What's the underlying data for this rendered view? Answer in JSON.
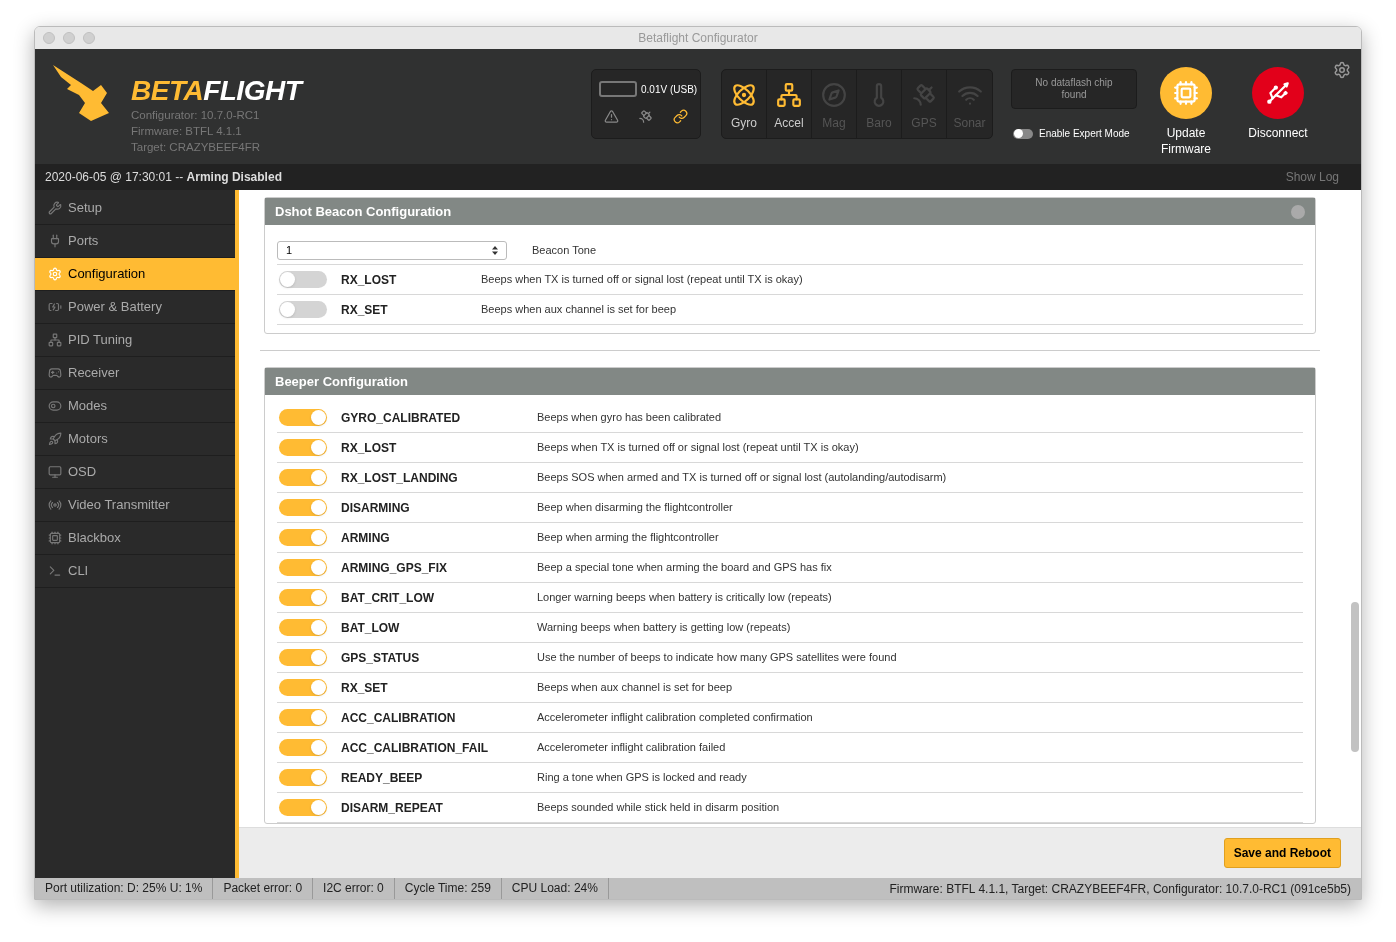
{
  "window": {
    "title": "Betaflight Configurator"
  },
  "logo": {
    "parts": [
      {
        "text": "BETA",
        "color": "#ffbb33"
      },
      {
        "text": "FLIGHT",
        "color": "#ffffff"
      }
    ],
    "info": [
      "Configurator: 10.7.0-RC1",
      "Firmware: BTFL 4.1.1",
      "Target: CRAZYBEEF4FR"
    ]
  },
  "battery": {
    "reading": "0.01V (USB)"
  },
  "sensors": [
    {
      "label": "Gyro",
      "kind": "gyro",
      "active": true
    },
    {
      "label": "Accel",
      "kind": "accel",
      "active": true
    },
    {
      "label": "Mag",
      "kind": "mag",
      "active": false
    },
    {
      "label": "Baro",
      "kind": "baro",
      "active": false
    },
    {
      "label": "GPS",
      "kind": "gps",
      "active": false
    },
    {
      "label": "Sonar",
      "kind": "sonar",
      "active": false
    }
  ],
  "dataflash": "No dataflash chip found",
  "expert_mode": {
    "label": "Enable Expert Mode",
    "on": false
  },
  "header_buttons": [
    {
      "label": "Update Firmware",
      "kind": "update"
    },
    {
      "label": "Disconnect",
      "kind": "disconnect"
    }
  ],
  "status_line": {
    "text": "2020-06-05 @ 17:30:01 -- **Arming Disabled**",
    "show_log": "Show Log"
  },
  "sidebar": {
    "items": [
      {
        "label": "Setup",
        "kind": "setup",
        "selected": false
      },
      {
        "label": "Ports",
        "kind": "ports",
        "selected": false
      },
      {
        "label": "Configuration",
        "kind": "config",
        "selected": true
      },
      {
        "label": "Power & Battery",
        "kind": "power",
        "selected": false
      },
      {
        "label": "PID Tuning",
        "kind": "pid",
        "selected": false
      },
      {
        "label": "Receiver",
        "kind": "receiver",
        "selected": false
      },
      {
        "label": "Modes",
        "kind": "modes",
        "selected": false
      },
      {
        "label": "Motors",
        "kind": "motors",
        "selected": false
      },
      {
        "label": "OSD",
        "kind": "osd",
        "selected": false
      },
      {
        "label": "Video Transmitter",
        "kind": "vtx",
        "selected": false
      },
      {
        "label": "Blackbox",
        "kind": "blackbox",
        "selected": false
      },
      {
        "label": "CLI",
        "kind": "cli",
        "selected": false
      }
    ]
  },
  "dshot_beacon": {
    "title": "Dshot Beacon Configuration",
    "tone": {
      "value": "1",
      "label": "Beacon Tone"
    },
    "rows": [
      {
        "name": "RX_LOST",
        "description": "Beeps when TX is turned off or signal lost (repeat until TX is okay)",
        "on": false
      },
      {
        "name": "RX_SET",
        "description": "Beeps when aux channel is set for beep",
        "on": false
      }
    ]
  },
  "beeper": {
    "title": "Beeper Configuration",
    "rows": [
      {
        "name": "GYRO_CALIBRATED",
        "description": "Beeps when gyro has been calibrated",
        "on": true
      },
      {
        "name": "RX_LOST",
        "description": "Beeps when TX is turned off or signal lost (repeat until TX is okay)",
        "on": true
      },
      {
        "name": "RX_LOST_LANDING",
        "description": "Beeps SOS when armed and TX is turned off or signal lost (autolanding/autodisarm)",
        "on": true
      },
      {
        "name": "DISARMING",
        "description": "Beep when disarming the flightcontroller",
        "on": true
      },
      {
        "name": "ARMING",
        "description": "Beep when arming the flightcontroller",
        "on": true
      },
      {
        "name": "ARMING_GPS_FIX",
        "description": "Beep a special tone when arming the board and GPS has fix",
        "on": true
      },
      {
        "name": "BAT_CRIT_LOW",
        "description": "Longer warning beeps when battery is critically low (repeats)",
        "on": true
      },
      {
        "name": "BAT_LOW",
        "description": "Warning beeps when battery is getting low (repeats)",
        "on": true
      },
      {
        "name": "GPS_STATUS",
        "description": "Use the number of beeps to indicate how many GPS satellites were found",
        "on": true
      },
      {
        "name": "RX_SET",
        "description": "Beeps when aux channel is set for beep",
        "on": true
      },
      {
        "name": "ACC_CALIBRATION",
        "description": "Accelerometer inflight calibration completed confirmation",
        "on": true
      },
      {
        "name": "ACC_CALIBRATION_FAIL",
        "description": "Accelerometer inflight calibration failed",
        "on": true
      },
      {
        "name": "READY_BEEP",
        "description": "Ring a tone when GPS is locked and ready",
        "on": true
      },
      {
        "name": "DISARM_REPEAT",
        "description": "Beeps sounded while stick held in disarm position",
        "on": true
      }
    ]
  },
  "save_button": "Save and Reboot",
  "status_bar": {
    "items": [
      "Port utilization: D: 25% U: 1%",
      "Packet error: 0",
      "I2C error: 0",
      "Cycle Time: 259",
      "CPU Load: 24%"
    ],
    "right": "Firmware: BTFL 4.1.1, Target: CRAZYBEEF4FR, Configurator: 10.7.0-RC1 (091ce5b5)"
  }
}
